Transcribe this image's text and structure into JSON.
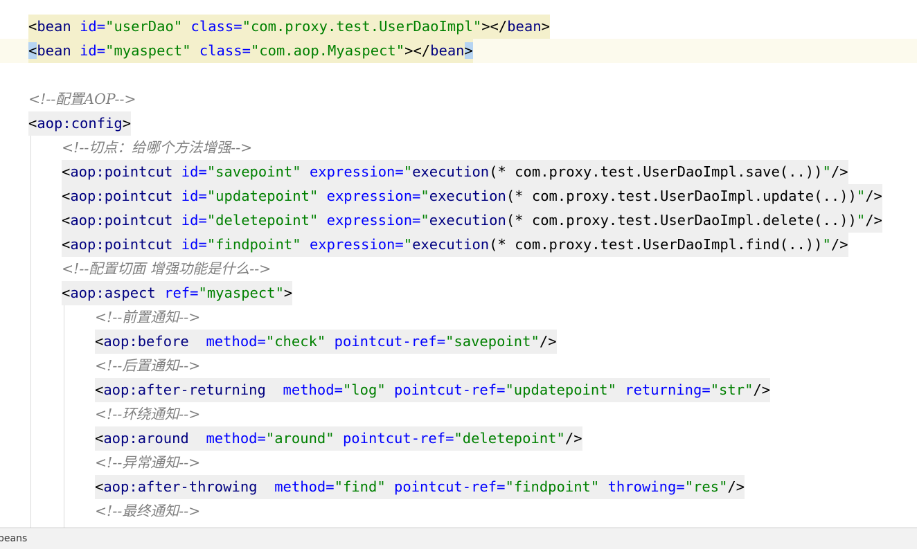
{
  "editor": {
    "lines": [
      {
        "id": "l1",
        "text": "<bean id=\"userDao\" class=\"com.proxy.test.UserDaoImpl\"></bean>"
      },
      {
        "id": "l2",
        "text": "<bean id=\"myaspect\" class=\"com.aop.Myaspect\"></bean>"
      },
      {
        "id": "l4",
        "text": "<!--配置AOP-->"
      },
      {
        "id": "l5",
        "text": "<aop:config>"
      },
      {
        "id": "l6",
        "text": "<!--切点：给哪个方法增强-->"
      },
      {
        "id": "l7",
        "text": "<aop:pointcut id=\"savepoint\" expression=\"execution(* com.proxy.test.UserDaoImpl.save(..))\"/>"
      },
      {
        "id": "l8",
        "text": "<aop:pointcut id=\"updatepoint\" expression=\"execution(* com.proxy.test.UserDaoImpl.update(..))\"/>"
      },
      {
        "id": "l9",
        "text": "<aop:pointcut id=\"deletepoint\" expression=\"execution(* com.proxy.test.UserDaoImpl.delete(..))\"/>"
      },
      {
        "id": "l10",
        "text": "<aop:pointcut id=\"findpoint\" expression=\"execution(* com.proxy.test.UserDaoImpl.find(..))\"/>"
      },
      {
        "id": "l11",
        "text": "<!--配置切面 增强功能是什么-->"
      },
      {
        "id": "l12",
        "text": "<aop:aspect ref=\"myaspect\">"
      },
      {
        "id": "l13",
        "text": "<!--前置通知-->"
      },
      {
        "id": "l14",
        "text": "<aop:before  method=\"check\" pointcut-ref=\"savepoint\"/>"
      },
      {
        "id": "l15",
        "text": "<!--后置通知-->"
      },
      {
        "id": "l16",
        "text": "<aop:after-returning  method=\"log\" pointcut-ref=\"updatepoint\" returning=\"str\"/>"
      },
      {
        "id": "l17",
        "text": "<!--环绕通知-->"
      },
      {
        "id": "l18",
        "text": "<aop:around  method=\"around\" pointcut-ref=\"deletepoint\"/>"
      },
      {
        "id": "l19",
        "text": "<!--异常通知-->"
      },
      {
        "id": "l20",
        "text": "<aop:after-throwing  method=\"find\" pointcut-ref=\"findpoint\" throwing=\"res\"/>"
      },
      {
        "id": "l21",
        "text": "<!--最终通知-->"
      }
    ]
  },
  "statusbar": {
    "breadcrumb": "beans"
  },
  "colors": {
    "tag": "#000080",
    "attribute": "#0000ff",
    "value": "#008000",
    "comment": "#808080",
    "highlight": "#f4f0cc",
    "caret_line": "#fcfaed"
  }
}
